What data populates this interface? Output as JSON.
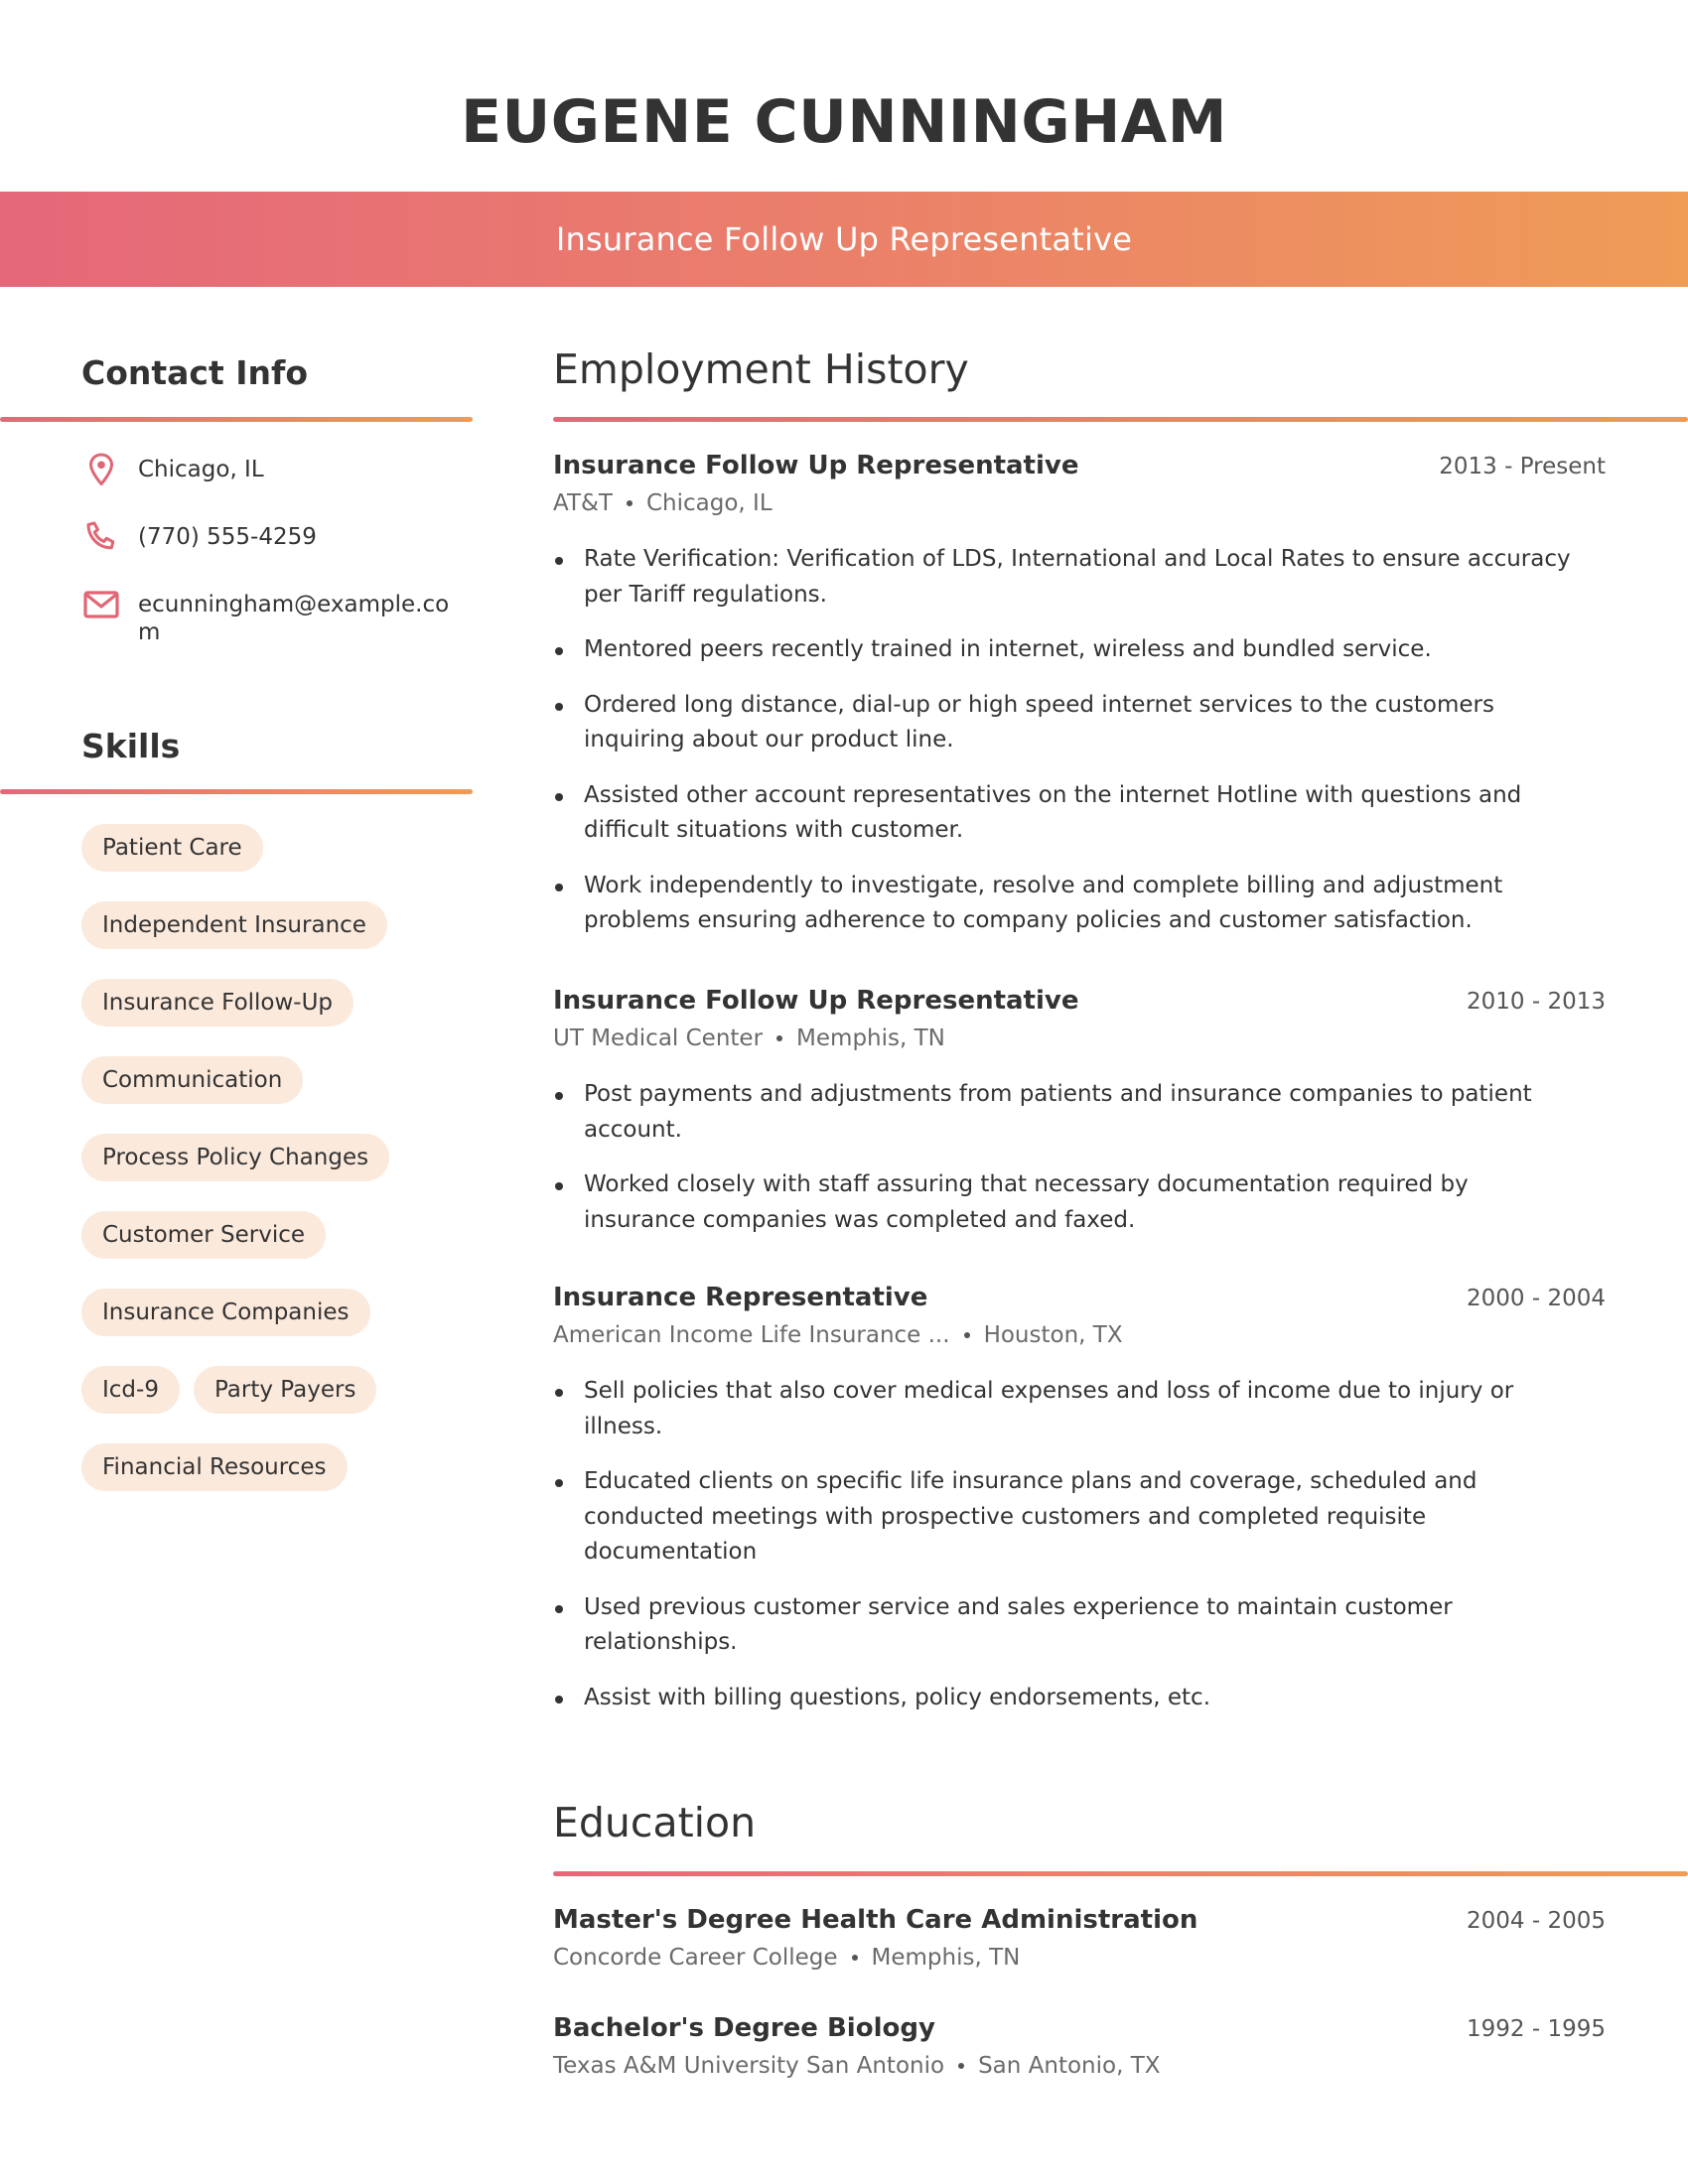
{
  "header": {
    "name": "EUGENE CUNNINGHAM",
    "job_title": "Insurance Follow Up Representative",
    "gradient_start": "#e5677a",
    "gradient_end": "#ef9c57"
  },
  "contact": {
    "heading": "Contact Info",
    "items": [
      {
        "icon": "map-pin-icon",
        "text": "Chicago, IL"
      },
      {
        "icon": "phone-icon",
        "text": "(770) 555-4259"
      },
      {
        "icon": "mail-icon",
        "text": "ecunningham@example.com"
      }
    ],
    "icon_color": "#e06675"
  },
  "skills": {
    "heading": "Skills",
    "items": [
      "Patient Care",
      "Independent Insurance",
      "Insurance Follow-Up",
      "Communication",
      "Process Policy Changes",
      "Customer Service",
      "Insurance Companies",
      "Icd-9",
      "Party Payers",
      "Financial Resources"
    ],
    "pill_color": "#fbe9dc"
  },
  "employment": {
    "heading": "Employment History",
    "jobs": [
      {
        "title": "Insurance Follow Up Representative",
        "dates": "2013 - Present",
        "company": "AT&T",
        "location": "Chicago, IL",
        "bullets": [
          "Rate Verification: Verification of LDS, International and Local Rates to ensure accuracy per Tariff regulations.",
          "Mentored peers recently trained in internet, wireless and bundled service.",
          "Ordered long distance, dial-up or high speed internet services to the customers inquiring about our product line.",
          "Assisted other account representatives on the internet Hotline with questions and difficult situations with customer.",
          "Work independently to investigate, resolve and complete billing and adjustment problems ensuring adherence to company policies and customer satisfaction."
        ]
      },
      {
        "title": "Insurance Follow Up Representative",
        "dates": "2010 - 2013",
        "company": "UT Medical Center",
        "location": "Memphis, TN",
        "bullets": [
          "Post payments and adjustments from patients and insurance companies to patient account.",
          "Worked closely with staff assuring that necessary documentation required by insurance companies was completed and faxed."
        ]
      },
      {
        "title": "Insurance Representative",
        "dates": "2000 - 2004",
        "company": "American Income Life Insurance ...",
        "location": "Houston, TX",
        "bullets": [
          "Sell policies that also cover medical expenses and loss of income due to injury or illness.",
          "Educated clients on specific life insurance plans and coverage, scheduled and conducted meetings with prospective customers and completed requisite documentation",
          "Used previous customer service and sales experience to maintain customer relationships.",
          "Assist with billing questions, policy endorsements, etc."
        ]
      }
    ]
  },
  "education": {
    "heading": "Education",
    "items": [
      {
        "degree": "Master's Degree Health Care Administration",
        "dates": "2004 - 2005",
        "school": "Concorde Career College",
        "location": "Memphis, TN"
      },
      {
        "degree": "Bachelor's Degree Biology",
        "dates": "1992 - 1995",
        "school": "Texas A&M University San Antonio",
        "location": "San Antonio, TX"
      }
    ]
  }
}
